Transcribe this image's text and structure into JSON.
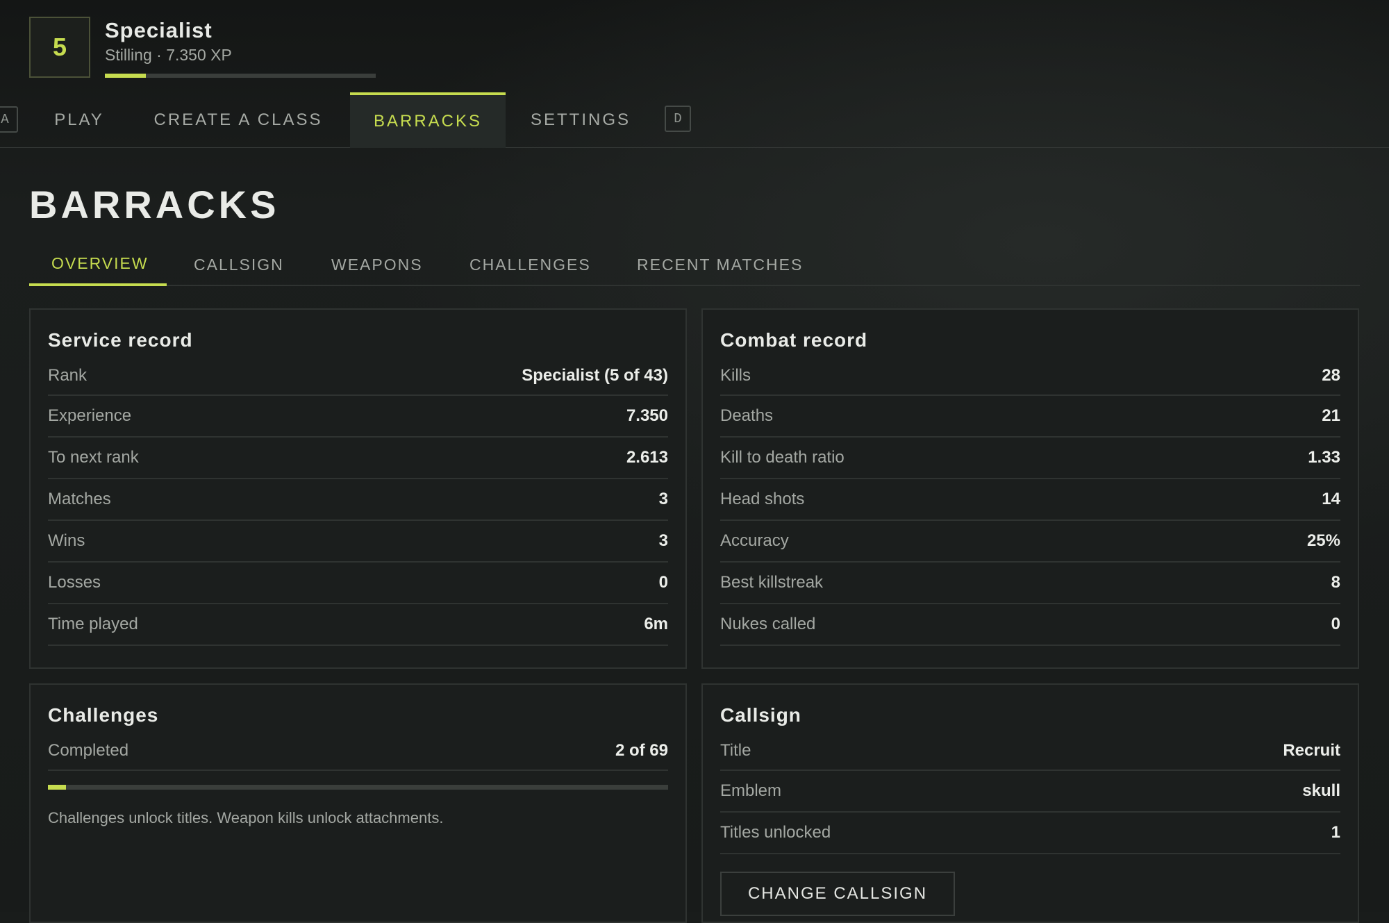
{
  "header": {
    "rank_number": "5",
    "rank_name": "Specialist",
    "rank_sub": "Stilling · 7.350 XP",
    "xp_progress": 0.15
  },
  "nav": {
    "left_key": "A",
    "right_key": "D",
    "tabs": [
      {
        "label": "PLAY"
      },
      {
        "label": "CREATE A CLASS"
      },
      {
        "label": "BARRACKS",
        "active": true
      },
      {
        "label": "SETTINGS"
      }
    ]
  },
  "page": {
    "title": "BARRACKS",
    "subtabs": [
      {
        "label": "OVERVIEW",
        "active": true
      },
      {
        "label": "CALLSIGN"
      },
      {
        "label": "WEAPONS"
      },
      {
        "label": "CHALLENGES"
      },
      {
        "label": "RECENT MATCHES"
      }
    ]
  },
  "service_record": {
    "title": "Service record",
    "rows": [
      {
        "label": "Rank",
        "value": "Specialist (5 of 43)"
      },
      {
        "label": "Experience",
        "value": "7.350"
      },
      {
        "label": "To next rank",
        "value": "2.613"
      },
      {
        "label": "Matches",
        "value": "3"
      },
      {
        "label": "Wins",
        "value": "3"
      },
      {
        "label": "Losses",
        "value": "0"
      },
      {
        "label": "Time played",
        "value": "6m"
      }
    ]
  },
  "combat_record": {
    "title": "Combat record",
    "rows": [
      {
        "label": "Kills",
        "value": "28"
      },
      {
        "label": "Deaths",
        "value": "21"
      },
      {
        "label": "Kill to death ratio",
        "value": "1.33"
      },
      {
        "label": "Head shots",
        "value": "14"
      },
      {
        "label": "Accuracy",
        "value": "25%"
      },
      {
        "label": "Best killstreak",
        "value": "8"
      },
      {
        "label": "Nukes called",
        "value": "0"
      }
    ]
  },
  "challenges": {
    "title": "Challenges",
    "completed_label": "Completed",
    "completed_value": "2 of 69",
    "progress": 0.029,
    "note": "Challenges unlock titles. Weapon kills unlock attachments."
  },
  "callsign": {
    "title": "Callsign",
    "rows": [
      {
        "label": "Title",
        "value": "Recruit"
      },
      {
        "label": "Emblem",
        "value": "skull"
      },
      {
        "label": "Titles unlocked",
        "value": "1"
      }
    ],
    "button_label": "CHANGE CALLSIGN"
  },
  "colors": {
    "accent": "#c6dc4f",
    "background": "#191c1b",
    "panel": "#1b1e1d",
    "divider": "#2f3331"
  }
}
